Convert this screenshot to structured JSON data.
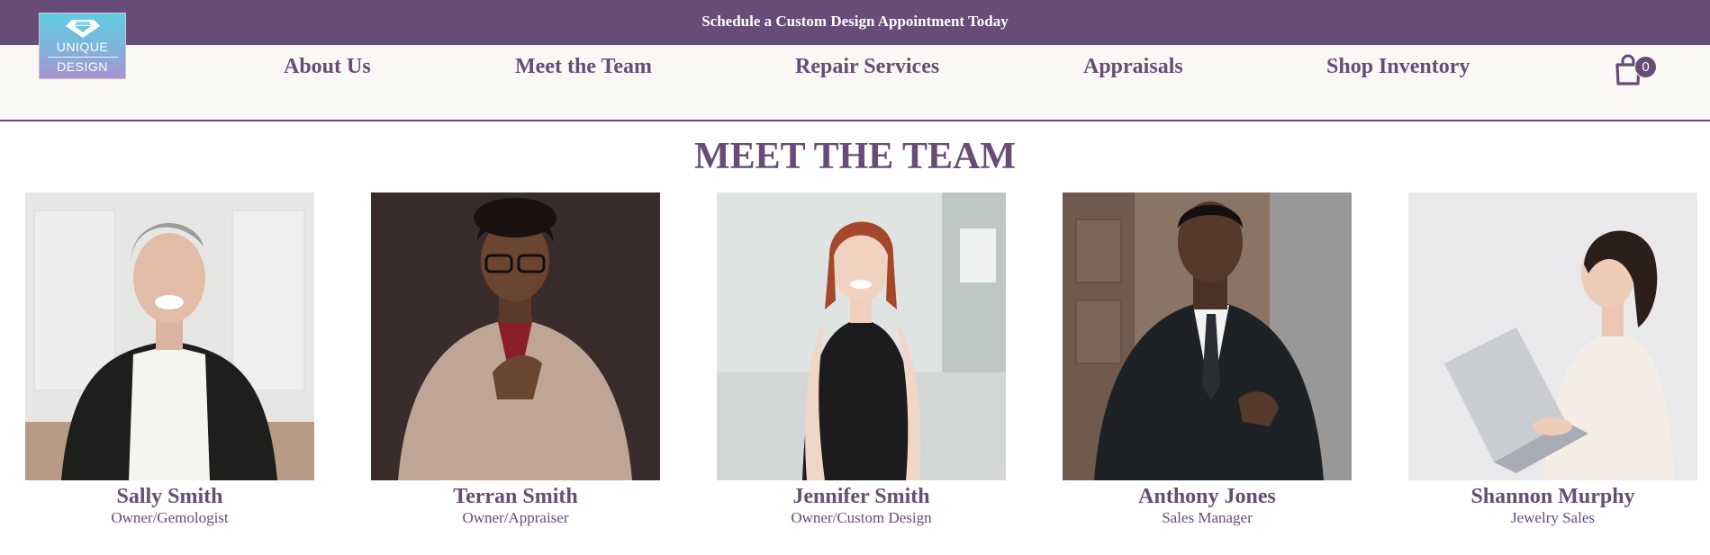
{
  "announcement": {
    "text": "Schedule a Custom Design Appointment Today"
  },
  "logo": {
    "line1": "UNIQUE",
    "line2": "DESIGN",
    "icon": "diamond-icon"
  },
  "nav": {
    "items": [
      {
        "label": "About Us"
      },
      {
        "label": "Meet the Team"
      },
      {
        "label": "Repair Services"
      },
      {
        "label": "Appraisals"
      },
      {
        "label": "Shop Inventory"
      }
    ],
    "cart": {
      "icon": "shopping-bag-icon",
      "count": "0"
    }
  },
  "page": {
    "title": "MEET THE TEAM"
  },
  "team": [
    {
      "name": "Sally Smith",
      "role": "Owner/Gemologist"
    },
    {
      "name": "Terran Smith",
      "role": "Owner/Appraiser"
    },
    {
      "name": "Jennifer Smith",
      "role": "Owner/Custom Design"
    },
    {
      "name": "Anthony Jones",
      "role": "Sales Manager"
    },
    {
      "name": "Shannon Murphy",
      "role": "Jewelry Sales"
    }
  ],
  "colors": {
    "brand": "#664c77",
    "nav_bg": "#faf8f5",
    "logo_top": "#5fcfe0",
    "logo_bottom": "#a993cf"
  }
}
